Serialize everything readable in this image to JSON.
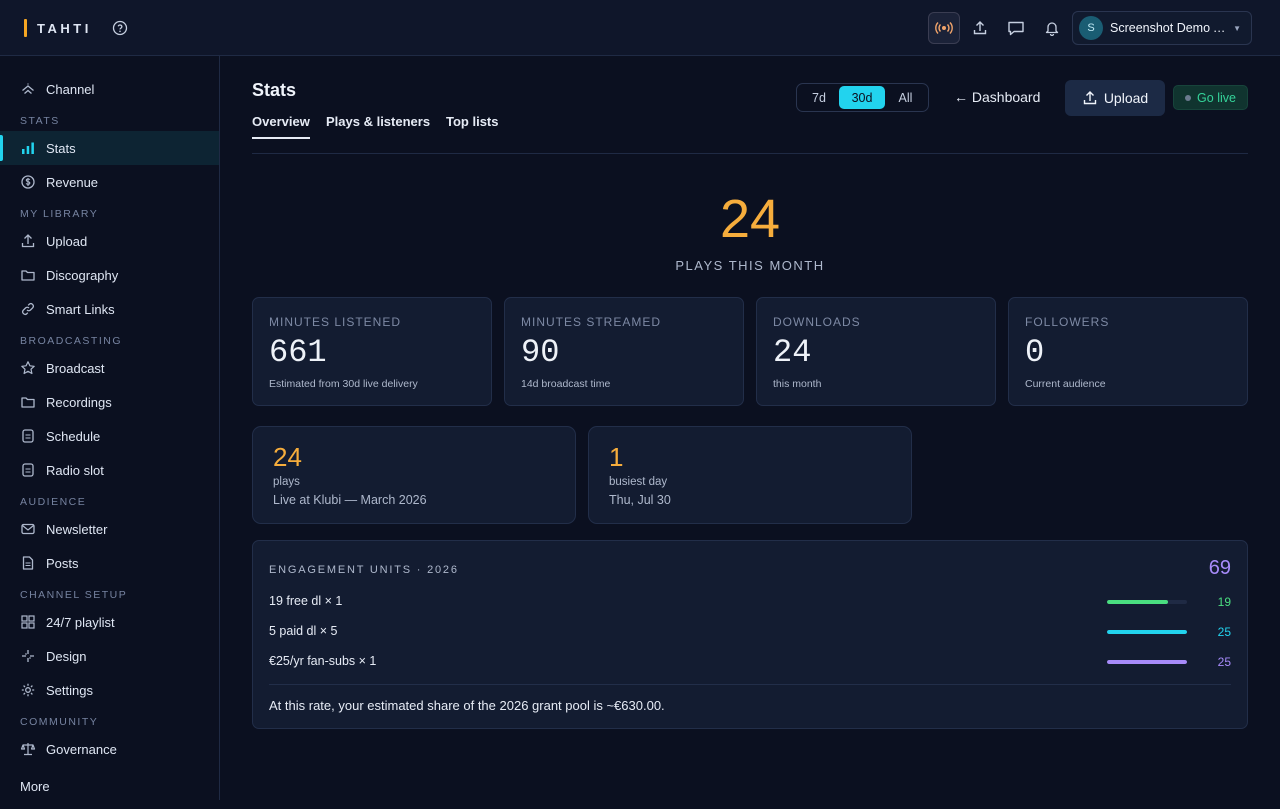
{
  "brand": {
    "name": "TAHTI",
    "accent": "#f5a623"
  },
  "topbar": {
    "account_initial": "S",
    "account_name": "Screenshot Demo A...",
    "icons": [
      "help-icon",
      "live-broadcast-icon",
      "upload-icon",
      "chat-icon",
      "bell-icon"
    ]
  },
  "sidebar": {
    "items": [
      {
        "label": "Channel",
        "icon": "channel-icon"
      },
      {
        "section": "STATS"
      },
      {
        "label": "Stats",
        "icon": "bar-chart-icon",
        "active": true
      },
      {
        "label": "Revenue",
        "icon": "coin-icon"
      },
      {
        "section": "MY LIBRARY"
      },
      {
        "label": "Upload",
        "icon": "upload-icon"
      },
      {
        "label": "Discography",
        "icon": "folder-icon"
      },
      {
        "label": "Smart Links",
        "icon": "link-icon"
      },
      {
        "section": "BROADCASTING"
      },
      {
        "label": "Broadcast",
        "icon": "star-icon"
      },
      {
        "label": "Recordings",
        "icon": "folder-icon"
      },
      {
        "label": "Schedule",
        "icon": "document-icon"
      },
      {
        "label": "Radio slot",
        "icon": "document-icon"
      },
      {
        "section": "AUDIENCE"
      },
      {
        "label": "Newsletter",
        "icon": "mail-icon"
      },
      {
        "label": "Posts",
        "icon": "page-icon"
      },
      {
        "section": "CHANNEL SETUP"
      },
      {
        "label": "24/7 playlist",
        "icon": "grid-icon"
      },
      {
        "label": "Design",
        "icon": "sparkle-icon"
      },
      {
        "label": "Settings",
        "icon": "gear-icon"
      },
      {
        "section": "COMMUNITY"
      },
      {
        "label": "Governance",
        "icon": "scales-icon"
      }
    ],
    "more_label": "More"
  },
  "header": {
    "title": "Stats",
    "tabs": [
      "Overview",
      "Plays & listeners",
      "Top lists"
    ],
    "active_tab": "Overview",
    "range": [
      "7d",
      "30d",
      "All"
    ],
    "selected_range": "30d",
    "dashboard_link": "← Dashboard",
    "upload_label": "Upload",
    "golive_label": "Go live"
  },
  "hero": {
    "value": "24",
    "label": "PLAYS THIS MONTH"
  },
  "stats": [
    {
      "label": "MINUTES LISTENED",
      "value": "661",
      "sub": "Estimated from 30d live delivery"
    },
    {
      "label": "MINUTES STREAMED",
      "value": "90",
      "sub": "14d broadcast time"
    },
    {
      "label": "DOWNLOADS",
      "value": "24",
      "sub": "this month"
    },
    {
      "label": "FOLLOWERS",
      "value": "0",
      "sub": "Current audience"
    }
  ],
  "highlights": [
    {
      "value": "24",
      "unit": "plays",
      "desc": "Live at Klubi — March 2026"
    },
    {
      "value": "1",
      "unit": "busiest day",
      "desc": "Thu, Jul 30"
    }
  ],
  "engagement": {
    "title": "ENGAGEMENT UNITS · 2026",
    "total": "69",
    "rows": [
      {
        "label": "19 free dl × 1",
        "value": "19",
        "fill": 0.76,
        "color": "#4ade80"
      },
      {
        "label": "5 paid dl × 5",
        "value": "25",
        "fill": 1.0,
        "color": "#22d3ee"
      },
      {
        "label": "€25/yr fan-subs × 1",
        "value": "25",
        "fill": 1.0,
        "color": "#a78bfa"
      }
    ],
    "footer": "At this rate, your estimated share of the 2026 grant pool is ~€630.00."
  }
}
